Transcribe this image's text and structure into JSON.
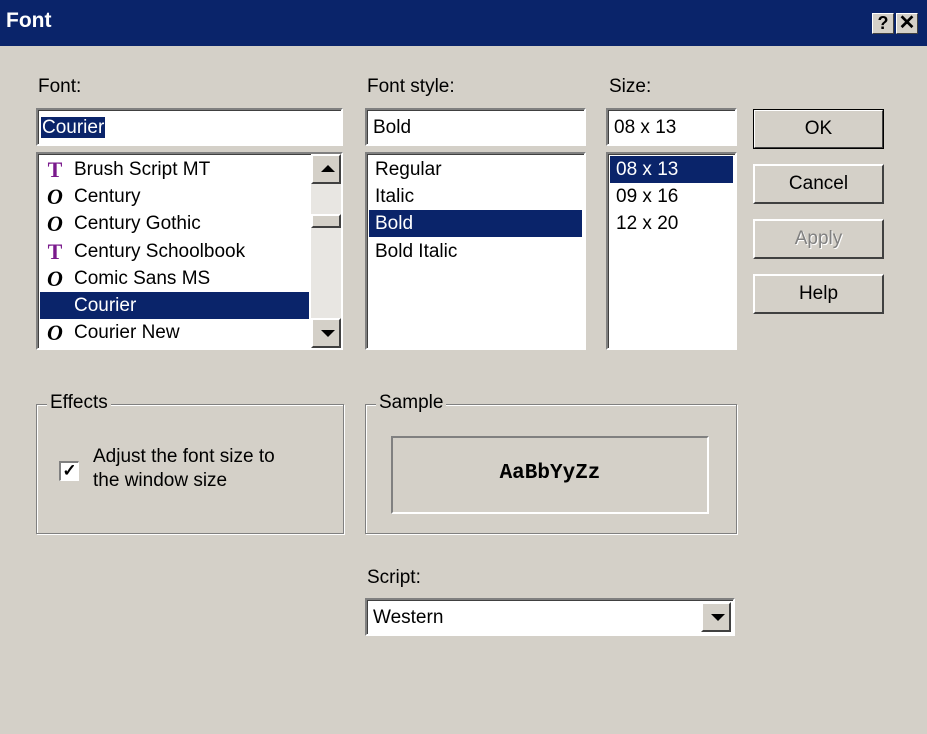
{
  "window": {
    "title": "Font",
    "help_glyph": "?",
    "close_glyph": "✕"
  },
  "font": {
    "label": "Font:",
    "value": "Courier",
    "items": [
      {
        "name": "Brush Script MT",
        "icon": "truetype-icon"
      },
      {
        "name": "Century",
        "icon": "opentype-icon"
      },
      {
        "name": "Century Gothic",
        "icon": "opentype-icon"
      },
      {
        "name": "Century Schoolbook",
        "icon": "truetype-icon"
      },
      {
        "name": "Comic Sans MS",
        "icon": "opentype-icon"
      },
      {
        "name": "Courier",
        "icon": "none",
        "selected": true
      },
      {
        "name": "Courier New",
        "icon": "opentype-icon"
      }
    ]
  },
  "style": {
    "label": "Font style:",
    "value": "Bold",
    "items": [
      "Regular",
      "Italic",
      "Bold",
      "Bold Italic"
    ],
    "selected_index": 2
  },
  "size": {
    "label": "Size:",
    "value": "08 x 13",
    "items": [
      "08 x 13",
      "09 x 16",
      "12 x 20"
    ],
    "selected_index": 0
  },
  "buttons": {
    "ok": "OK",
    "cancel": "Cancel",
    "apply": "Apply",
    "help": "Help"
  },
  "effects": {
    "title": "Effects",
    "checkbox_label_line1": "Adjust the font size to",
    "checkbox_label_line2": "the window size",
    "checked": true,
    "check_glyph": "✓"
  },
  "sample": {
    "title": "Sample",
    "text": "AaBbYyZz"
  },
  "script": {
    "label": "Script:",
    "value": "Western"
  },
  "colors": {
    "titlebar": "#0a246a",
    "face": "#d4d0c8",
    "selection": "#0a246a",
    "truetype_icon": "#7a1a8c"
  }
}
